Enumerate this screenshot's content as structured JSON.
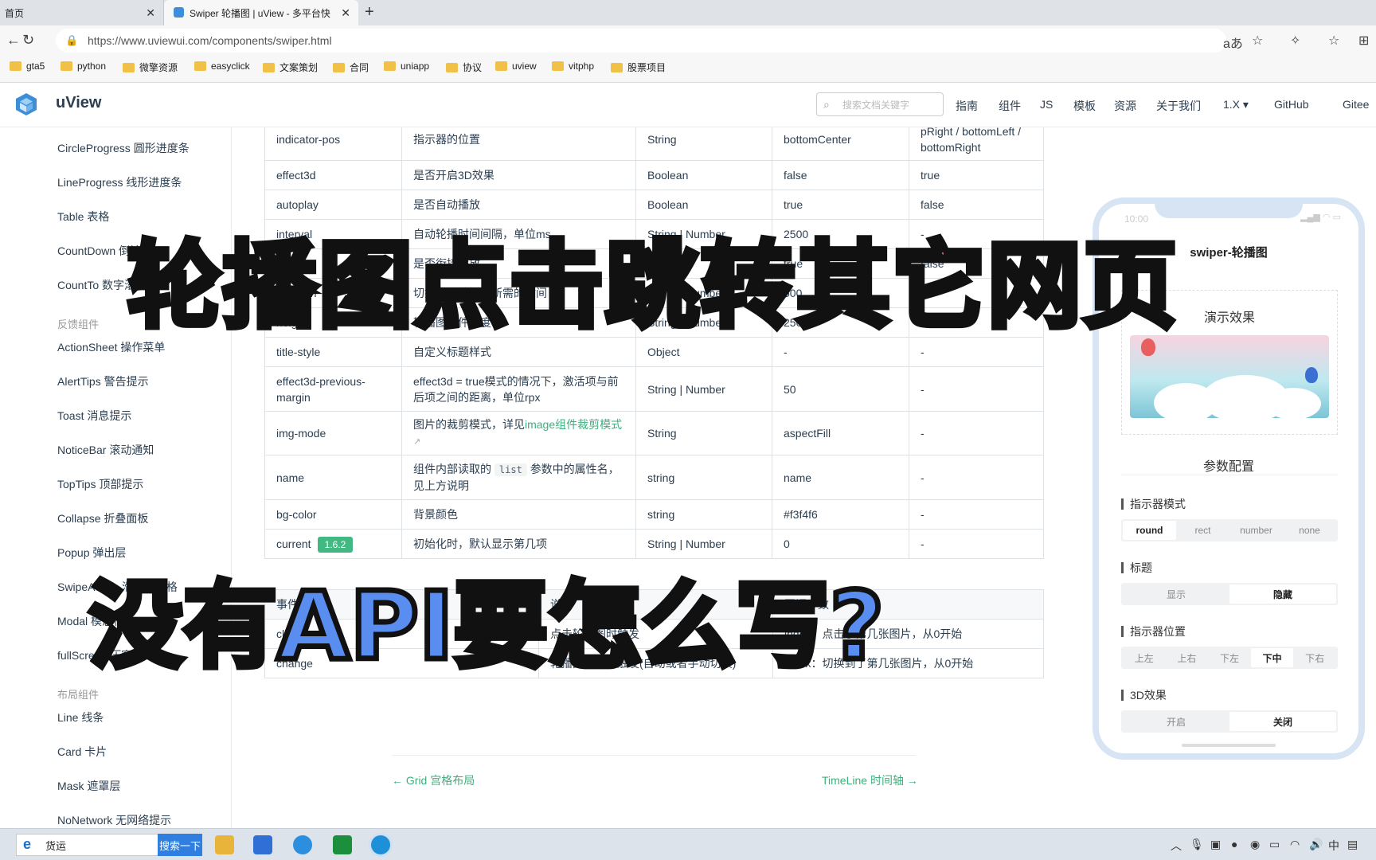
{
  "browser": {
    "tabs": [
      {
        "label": "首页"
      },
      {
        "label": "Swiper 轮播图 | uView - 多平台快"
      }
    ],
    "url": "https://www.uviewui.com/components/swiper.html",
    "bookmarks": [
      "gta5",
      "python",
      "微擎资源",
      "easyclick",
      "文案策划",
      "合同",
      "uniapp",
      "协议",
      "uview",
      "vitphp",
      "股票项目"
    ]
  },
  "header": {
    "brand": "uView",
    "search_placeholder": "搜索文档关键字",
    "nav": [
      "指南",
      "组件",
      "JS",
      "模板",
      "资源",
      "关于我们",
      "1.X ▾",
      "GitHub",
      "Gitee"
    ]
  },
  "sidebar": {
    "items": [
      "CircleProgress 圆形进度条",
      "LineProgress 线形进度条",
      "Table 表格",
      "CountDown 倒计时",
      "CountTo 数字滚动"
    ],
    "group_feedback": "反馈组件",
    "feedback_items": [
      "ActionSheet 操作菜单",
      "AlertTips 警告提示",
      "Toast 消息提示",
      "NoticeBar 滚动通知",
      "TopTips 顶部提示",
      "Collapse 折叠面板",
      "Popup 弹出层",
      "SwipeAction 滑动单元格",
      "Modal 模态框",
      "fullScreen 压窗屏"
    ],
    "group_layout": "布局组件",
    "layout_items": [
      "Line 线条",
      "Card 卡片",
      "Mask 遮罩层",
      "NoNetwork 无网络提示"
    ]
  },
  "api_table": {
    "rows": [
      [
        "indicator-pos",
        "指示器的位置",
        "String",
        "bottomCenter",
        "pRight / bottomLeft / bottomRight"
      ],
      [
        "effect3d",
        "是否开启3D效果",
        "Boolean",
        "false",
        "true"
      ],
      [
        "autoplay",
        "是否自动播放",
        "Boolean",
        "true",
        "false"
      ],
      [
        "interval",
        "自动轮播时间间隔，单位ms",
        "String | Number",
        "2500",
        "-"
      ],
      [
        "circular",
        "是否衔接播放",
        "Boolean",
        "true",
        "false"
      ],
      [
        "duration",
        "切换一张轮播图所需的时间",
        "String | Number",
        "500",
        "-"
      ],
      [
        "height",
        "轮播图组件高度",
        "String | Number",
        "250",
        "-"
      ],
      [
        "title-style",
        "自定义标题样式",
        "Object",
        "-",
        "-"
      ],
      [
        "effect3d-previous-margin",
        "effect3d = true模式的情况下，激活项与前后项之间的距离，单位rpx",
        "String | Number",
        "50",
        "-"
      ],
      [
        "img-mode",
        "图片的裁剪模式，详见",
        "String",
        "aspectFill",
        "-"
      ],
      [
        "name",
        "组件内部读取的",
        "string",
        "name",
        "-"
      ],
      [
        "bg-color",
        "背景颜色",
        "string",
        "#f3f4f6",
        "-"
      ],
      [
        "current",
        "初始化时，默认显示第几项",
        "String | Number",
        "0",
        "-"
      ]
    ],
    "img_mode_link": "image组件裁剪模式",
    "name_code": "list",
    "name_suffix": "参数中的属性名，见上方说明",
    "current_tag": "1.6.2"
  },
  "events_table": {
    "header": [
      "事件名",
      "说明",
      "回调参数"
    ],
    "rows": [
      [
        "click",
        "点击轮播图时触发",
        "index：点击了第几张图片，从0开始"
      ],
      [
        "change",
        "轮播图切换时触发(自动或者手动切换)",
        "index：切换到了第几张图片，从0开始"
      ]
    ]
  },
  "pager": {
    "prev": "← Grid 宫格布局",
    "next": "TimeLine 时间轴 →"
  },
  "phone": {
    "time": "10:00",
    "title": "swiper-轮播图",
    "demo_title": "演示效果",
    "param_title": "参数配置",
    "groups": [
      {
        "label": "指示器模式",
        "options": [
          "round",
          "rect",
          "number",
          "none"
        ],
        "selected": "round"
      },
      {
        "label": "标题",
        "options": [
          "显示",
          "隐藏"
        ],
        "selected": "隐藏"
      },
      {
        "label": "指示器位置",
        "options": [
          "上左",
          "上右",
          "下左",
          "下中",
          "下右"
        ],
        "selected": "下中"
      },
      {
        "label": "3D效果",
        "options": [
          "开启",
          "关闭"
        ],
        "selected": "关闭"
      }
    ]
  },
  "overlay": {
    "line1": "轮播图点击跳转其它网页",
    "line2": "没有API要怎么写?"
  },
  "taskbar": {
    "search_value": "货运",
    "search_button": "搜索一下"
  },
  "colors": {
    "accent": "#3eaf7c",
    "overlay_pink": "#ff6fa8",
    "overlay_blue": "#5a8df0"
  }
}
